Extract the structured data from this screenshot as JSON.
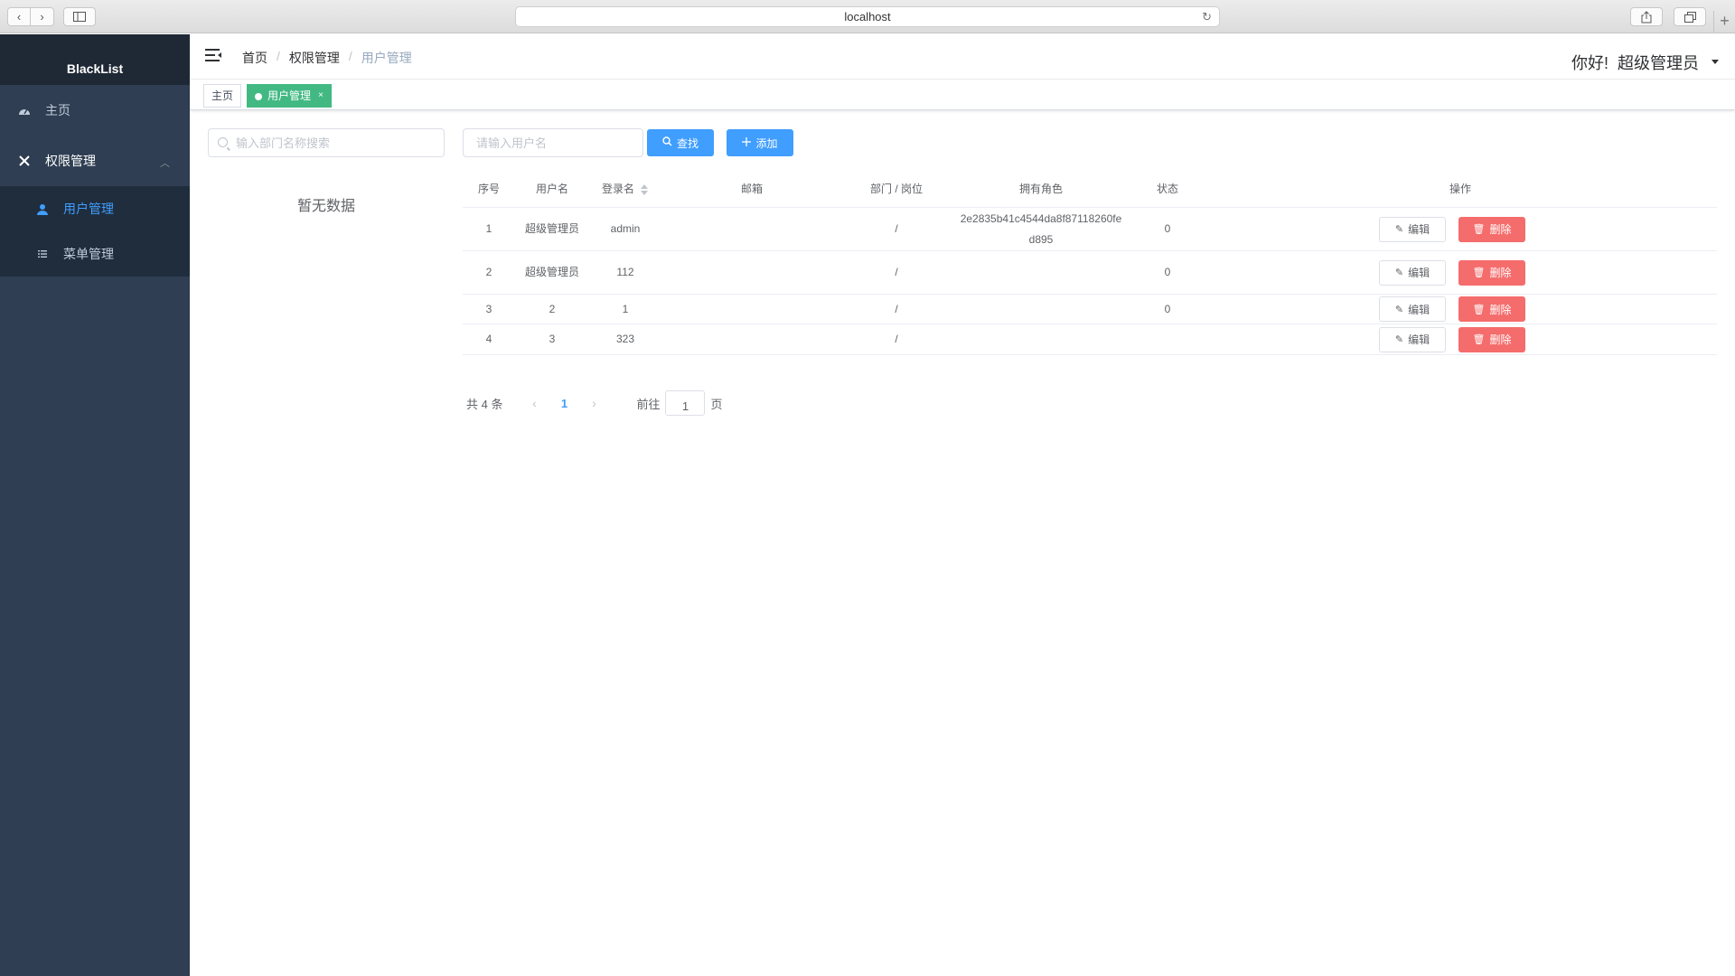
{
  "browser": {
    "url": "localhost",
    "icons": {
      "back": "chevron-left-icon",
      "forward": "chevron-right-icon",
      "sidebar": "sidebar-icon",
      "reload": "reload-icon",
      "share": "share-icon",
      "tabs": "tabs-icon",
      "new_tab": "plus-icon"
    }
  },
  "sidebar": {
    "brand": "BlackList",
    "items": [
      {
        "label": "主页",
        "icon": "dashboard-icon"
      },
      {
        "label": "权限管理",
        "icon": "tools-icon",
        "expanded": true,
        "children": [
          {
            "label": "用户管理",
            "icon": "user-icon",
            "active": true
          },
          {
            "label": "菜单管理",
            "icon": "list-icon"
          }
        ]
      }
    ]
  },
  "header": {
    "breadcrumb": [
      "首页",
      "权限管理",
      "用户管理"
    ],
    "breadcrumb_separator": "/",
    "greeting": "你好!  超级管理员"
  },
  "tags": {
    "home": "主页",
    "active": "用户管理",
    "close": "×"
  },
  "dept_tree": {
    "search_placeholder": "输入部门名称搜索",
    "empty_text": "暂无数据"
  },
  "toolbar": {
    "username_placeholder": "请输入用户名",
    "search_label": "查找",
    "add_label": "添加"
  },
  "table": {
    "columns": [
      "序号",
      "用户名",
      "登录名",
      "邮箱",
      "部门 / 岗位",
      "拥有角色",
      "状态",
      "操作"
    ],
    "rows": [
      {
        "idx": "1",
        "username": "超级管理员",
        "login": "admin",
        "email": "",
        "dept": "/",
        "role": "2e2835b41c4544da8f87118260fed895",
        "state": "0"
      },
      {
        "idx": "2",
        "username": "超级管理员",
        "login": "112",
        "email": "",
        "dept": "/",
        "role": "",
        "state": "0"
      },
      {
        "idx": "3",
        "username": "2",
        "login": "1",
        "email": "",
        "dept": "/",
        "role": "",
        "state": "0"
      },
      {
        "idx": "4",
        "username": "3",
        "login": "323",
        "email": "",
        "dept": "/",
        "role": "",
        "state": ""
      }
    ],
    "edit_label": "编辑",
    "delete_label": "删除"
  },
  "pagination": {
    "total_text": "共 4 条",
    "current_page": "1",
    "jump_label": "前往",
    "jump_value": "1",
    "page_suffix": "页"
  },
  "colors": {
    "sidebar_bg": "#2f3e52",
    "submenu_bg": "#1f2d3d",
    "primary": "#409eff",
    "danger": "#f56c6c",
    "tag_active": "#42b983"
  }
}
